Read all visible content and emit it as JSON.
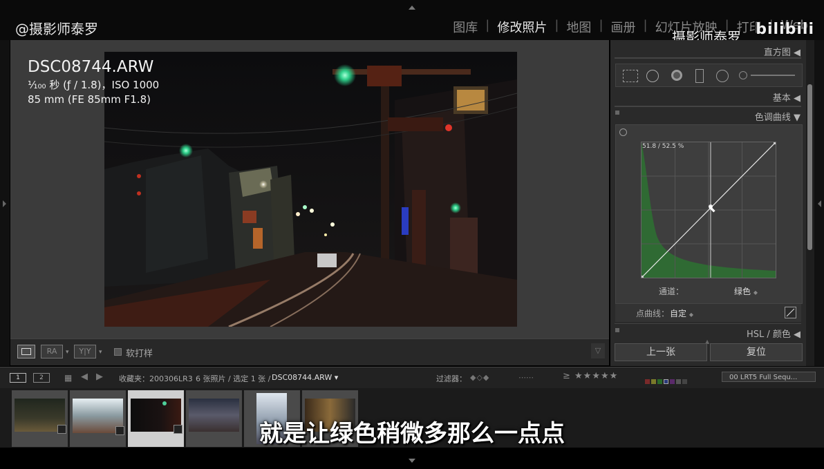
{
  "top": {
    "watermark": "@摄影师泰罗",
    "modules": [
      "图库",
      "修改照片",
      "地图",
      "画册",
      "幻灯片放映",
      "打印",
      "Web"
    ],
    "active_module": "修改照片",
    "bili_name": "摄影师泰罗",
    "bili_logo": "bilibili"
  },
  "photo_info": {
    "filename": "DSC08744.ARW",
    "exposure": "¹⁄₁₀₀ 秒 (ƒ / 1.8)，ISO 1000",
    "lens": "85 mm (FE 85mm F1.8)"
  },
  "toolbar": {
    "soft_proof_label": "软打样",
    "compare_ra": "RA",
    "compare_yy": "Y|Y"
  },
  "right_panel": {
    "histogram_label": "直方图",
    "basic_label": "基本",
    "tone_curve_label": "色调曲线",
    "curve_readout": "51.8 / 52.5 %",
    "channel_label": "通道：",
    "channel_value": "绿色",
    "point_curve_label": "点曲线：",
    "point_curve_value": "自定",
    "hsl_label": "HSL / 颜色",
    "prev_button": "上一张",
    "reset_button": "复位"
  },
  "filmbar": {
    "page1": "1",
    "page2": "2",
    "collection": "收藏夹：200306LR3",
    "count": "6 张照片 / 选定 1 张 /",
    "selected_file": "DSC08744.ARW",
    "filter_label": "过滤器：",
    "preset": "00 LRT5 Full Sequ..."
  },
  "filmstrip_selected_index": 2,
  "subtitle": "就是让绿色稍微多那么一点点",
  "colors": {
    "panel_bg": "#2a2a2a",
    "view_bg": "#3b3b3b",
    "histogram_green": "#2f6a33"
  }
}
